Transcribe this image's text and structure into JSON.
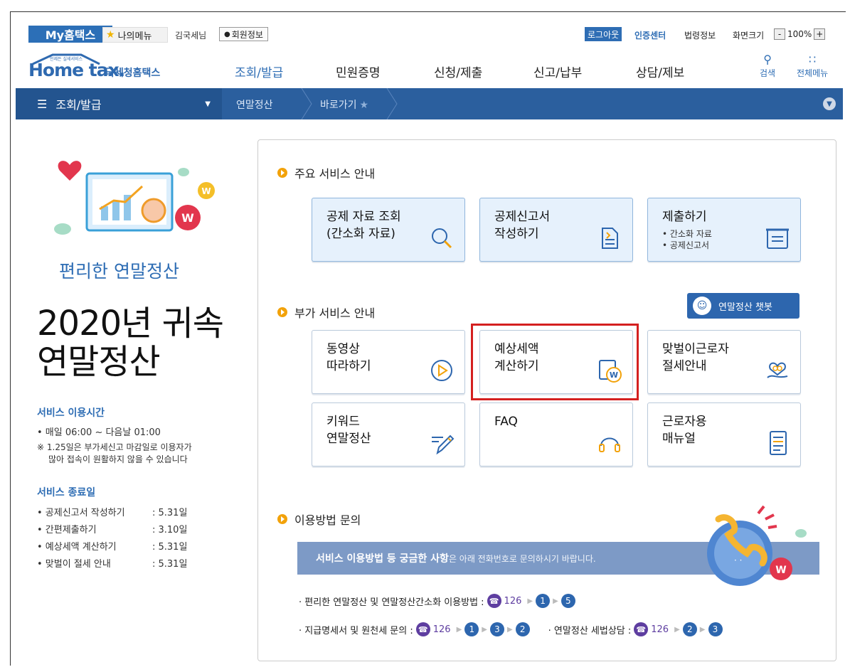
{
  "util": {
    "my_label": "My홈택스",
    "my_menu": "나의메뉴",
    "user": "김국세님",
    "member_info": "회원정보",
    "logout": "로그아웃",
    "cert_center": "인증센터",
    "law_info": "법령정보",
    "screen_size": "화면크기",
    "zoom_minus": "-",
    "zoom_value": "100%",
    "zoom_plus": "+"
  },
  "logo": {
    "en": "Home tax.",
    "kr": "국세청홈택스",
    "small": "언제든 실세서비스"
  },
  "nav": {
    "items": [
      "조회/발급",
      "민원증명",
      "신청/제출",
      "신고/납부",
      "상담/제보"
    ],
    "search": "검색",
    "all_menu": "전체메뉴"
  },
  "crumb": {
    "menu": "조회/발급",
    "current": "연말정산",
    "shortcut": "바로가기"
  },
  "left": {
    "subtitle": "편리한 연말정산",
    "title_line1": "2020년 귀속",
    "title_line2": "연말정산",
    "hours_head": "서비스 이용시간",
    "hours_line": "• 매일 06:00 ~ 다음날 01:00",
    "hours_note1": "※ 1.25일은 부가세신고 마감일로 이용자가",
    "hours_note2": "많아 접속이 원활하지 않을 수 있습니다",
    "end_head": "서비스 종료일",
    "end_items": [
      {
        "label": "• 공제신고서 작성하기",
        "date": ": 5.31일"
      },
      {
        "label": "• 간편제출하기",
        "date": ": 3.10일"
      },
      {
        "label": "• 예상세액 계산하기",
        "date": ": 5.31일"
      },
      {
        "label": "• 맞벌이 절세 안내",
        "date": ": 5.31일"
      }
    ]
  },
  "main": {
    "sec1": "주요 서비스 안내",
    "main_services": [
      {
        "line1": "공제 자료 조회",
        "line2": "(간소화 자료)"
      },
      {
        "line1": "공제신고서",
        "line2": "작성하기"
      },
      {
        "line1": "제출하기",
        "bullet1": "• 간소화 자료",
        "bullet2": "• 공제신고서"
      }
    ],
    "sec2": "부가 서비스 안내",
    "chatbot": "연말정산 챗봇",
    "extra_services": [
      {
        "line1": "동영상",
        "line2": "따라하기"
      },
      {
        "line1": "예상세액",
        "line2": "계산하기"
      },
      {
        "line1": "맞벌이근로자",
        "line2": "절세안내"
      },
      {
        "line1": "키워드",
        "line2": "연말정산"
      },
      {
        "line1": "FAQ",
        "line2": ""
      },
      {
        "line1": "근로자용",
        "line2": "매뉴얼"
      }
    ],
    "sec3": "이용방법 문의",
    "banner_bold": "서비스 이용방법 등 궁금한 사항",
    "banner_rest": "은 아래 전화번호로 문의하시기 바랍니다.",
    "phone1_label": "· 편리한 연말정산 및 연말정산간소화 이용방법 :",
    "phone_number": "126",
    "phone1_steps": [
      "1",
      "5"
    ],
    "phone2_label": "· 지급명세서 및 원천세 문의 :",
    "phone2_steps": [
      "1",
      "3",
      "2"
    ],
    "phone3_label": "· 연말정산 세법상담 :",
    "phone3_steps": [
      "2",
      "3"
    ]
  }
}
